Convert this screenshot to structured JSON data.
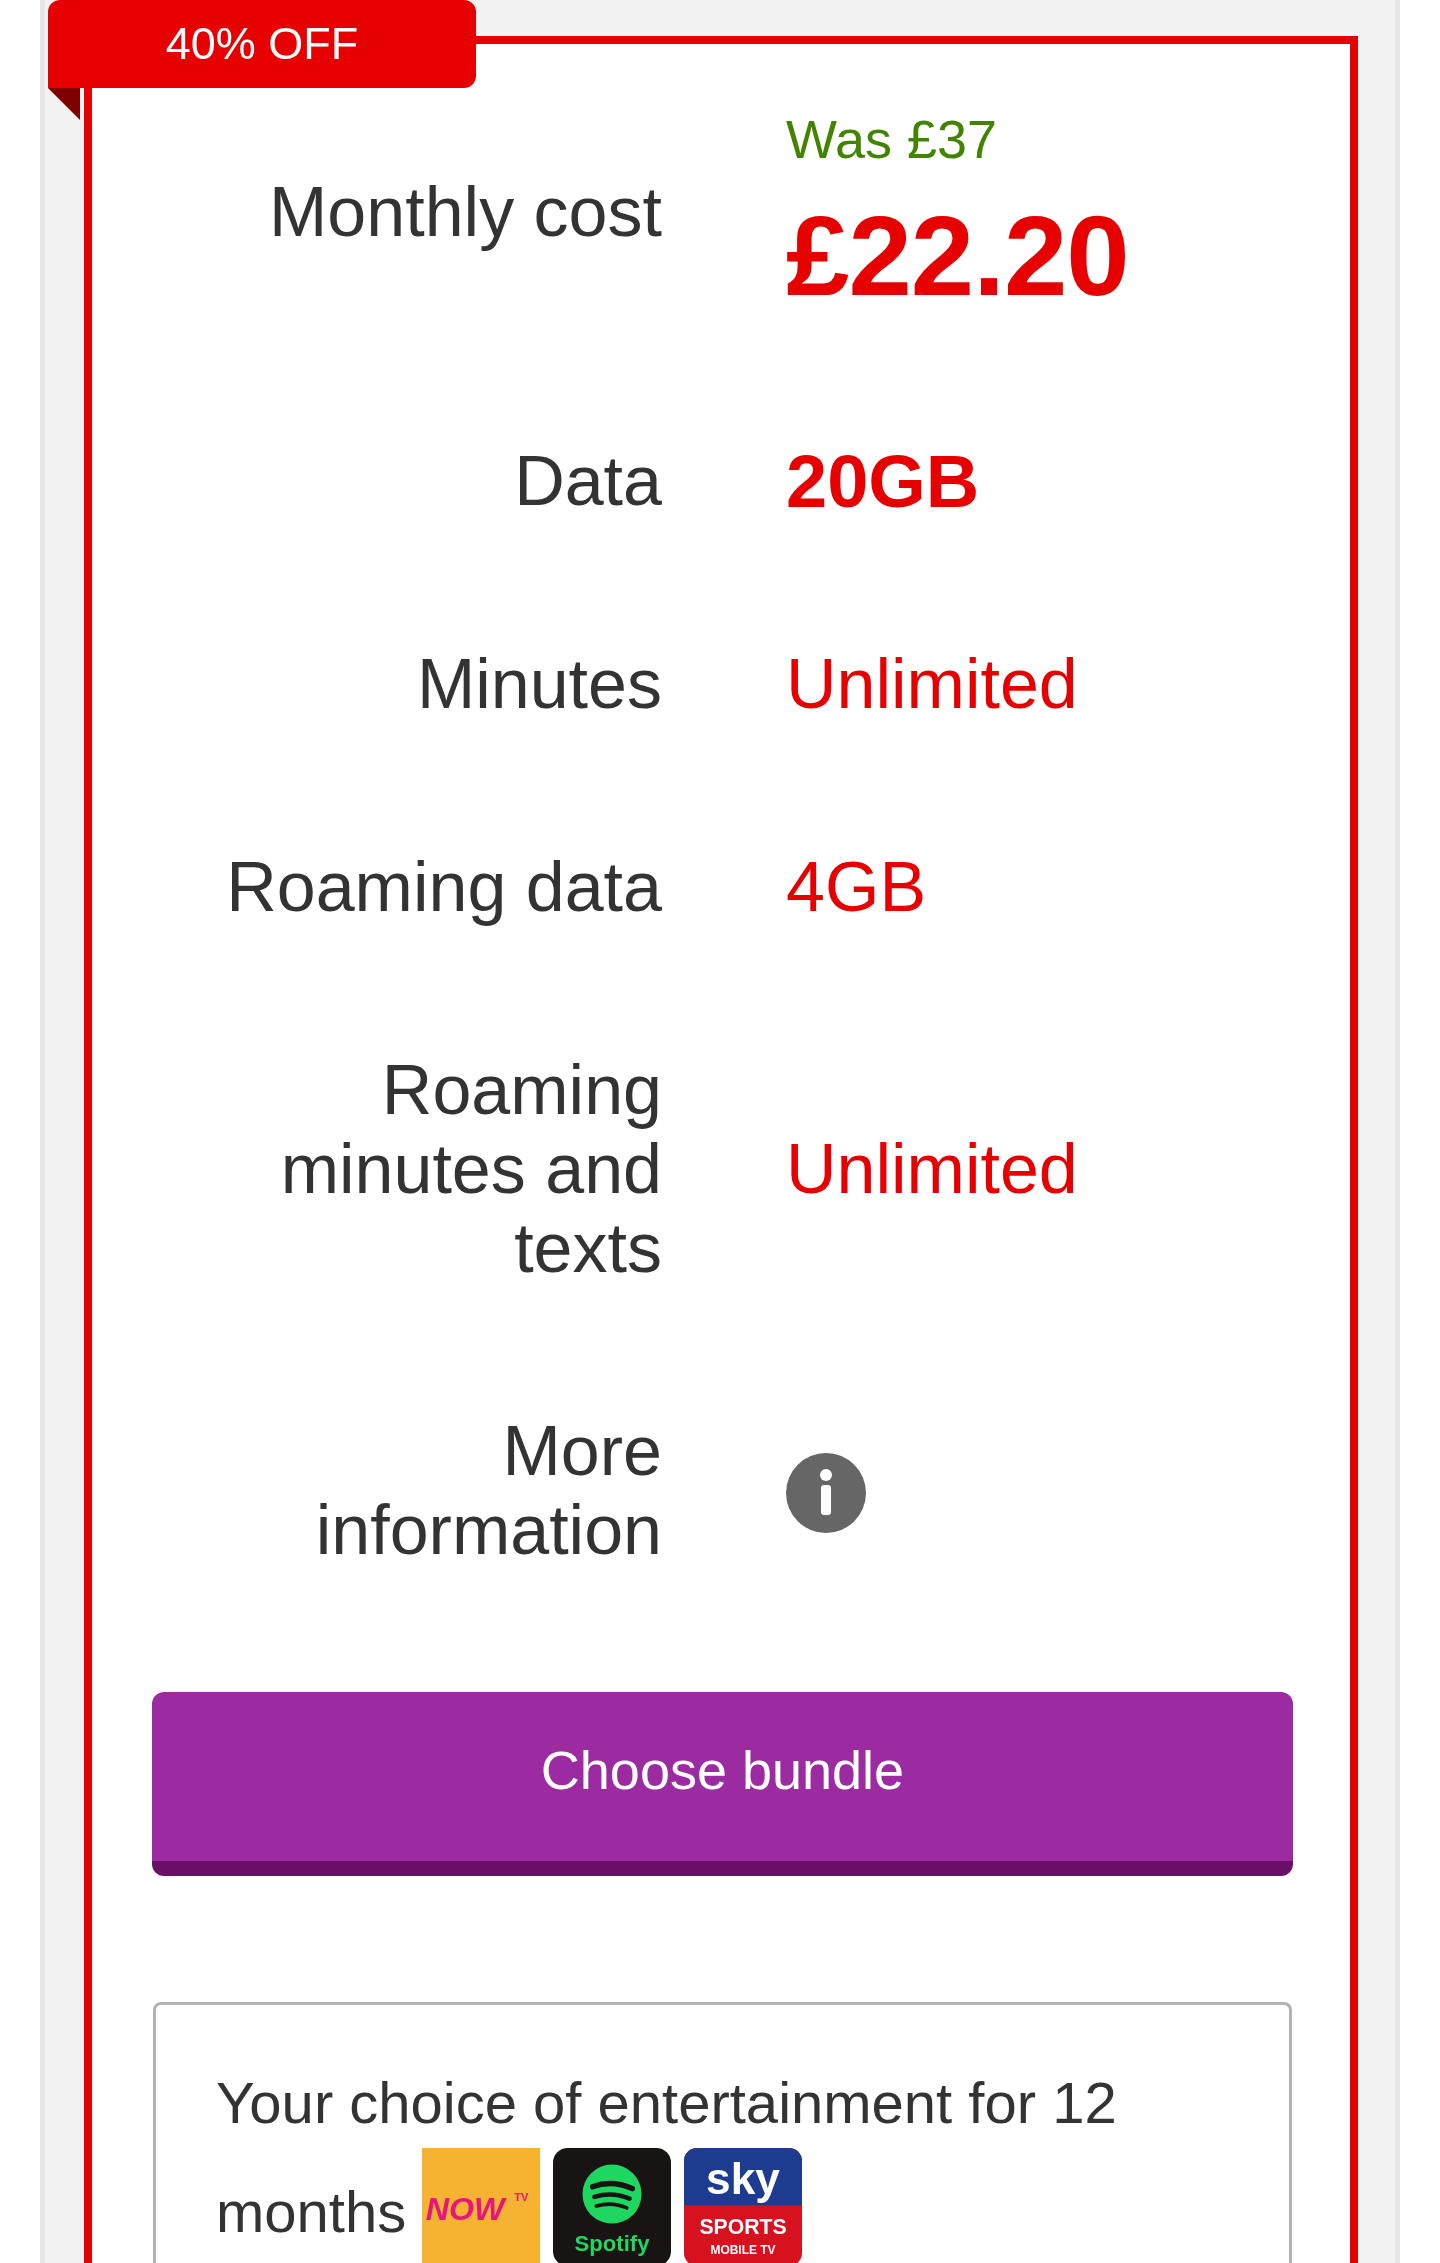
{
  "offer_badge": {
    "text": "40% OFF"
  },
  "price": {
    "label": "Monthly cost",
    "was": "Was £37",
    "now": "£22.20"
  },
  "features": [
    {
      "kind": "bold",
      "label": "Data",
      "value": "20GB"
    },
    {
      "kind": "text",
      "label": "Minutes",
      "value": "Unlimited"
    },
    {
      "kind": "text",
      "label": "Roaming data",
      "value": "4GB"
    },
    {
      "kind": "text",
      "label": "Roaming minutes and texts",
      "value": "Unlimited"
    },
    {
      "kind": "info",
      "label": "More information"
    }
  ],
  "button": {
    "label": "Choose bundle"
  },
  "entertainment": {
    "text": "Your choice of entertainment for 12 months",
    "logos": [
      {
        "kind": "now-tv",
        "wordmark": "NOW",
        "superscript": "TV"
      },
      {
        "kind": "spotify",
        "wordmark": "Spotify"
      },
      {
        "kind": "sky-sports",
        "wordmark": "sky",
        "subtitle": "SPORTS",
        "caption": "MOBILE TV"
      }
    ]
  }
}
